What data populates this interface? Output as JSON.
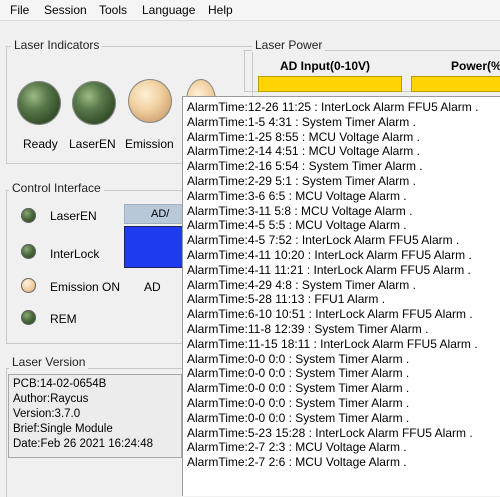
{
  "menu": [
    "File",
    "Session",
    "Tools",
    "Language",
    "Help"
  ],
  "laser_indicators": {
    "title": "Laser Indicators",
    "items": [
      {
        "label": "Ready",
        "state": "green"
      },
      {
        "label": "LaserEN",
        "state": "green"
      },
      {
        "label": "Emission",
        "state": "peach"
      }
    ]
  },
  "laser_power": {
    "title": "Laser Power",
    "ad_input_label": "AD Input(0-10V)",
    "power_label": "Power(%"
  },
  "control_interface": {
    "title": "Control Interface",
    "items": [
      {
        "label": "LaserEN",
        "state": "green"
      },
      {
        "label": "InterLock",
        "state": "green"
      },
      {
        "label": "Emission ON",
        "state": "peach"
      },
      {
        "label": "REM",
        "state": "green"
      }
    ],
    "ad_header": "AD/",
    "ad_label": "AD"
  },
  "laser_version": {
    "title": "Laser Version",
    "lines": [
      "PCB:14-02-0654B",
      "Author:Raycus",
      "Version:3.7.0",
      "Brief:Single Module",
      "Date:Feb 26 2021  16:24:48"
    ]
  },
  "alarms": [
    "AlarmTime:12-26 11:25  :   InterLock Alarm  FFU5 Alarm  .",
    "AlarmTime:1-5 4:31  :   System Timer Alarm  .",
    "AlarmTime:1-25 8:55  :   MCU Voltage Alarm  .",
    "AlarmTime:2-14 4:51  :   MCU Voltage Alarm  .",
    "AlarmTime:2-16 5:54  :   System Timer Alarm  .",
    "AlarmTime:2-29 5:1  :   System Timer Alarm  .",
    "AlarmTime:3-6 6:5  :   MCU Voltage Alarm  .",
    "AlarmTime:3-11 5:8  :   MCU Voltage Alarm  .",
    "AlarmTime:4-5 5:5  :   MCU Voltage Alarm  .",
    "AlarmTime:4-5 7:52  :   InterLock Alarm  FFU5 Alarm  .",
    "AlarmTime:4-11 10:20  :   InterLock Alarm  FFU5 Alarm  .",
    "AlarmTime:4-11 11:21  :   InterLock Alarm  FFU5 Alarm  .",
    "AlarmTime:4-29 4:8  :   System Timer Alarm  .",
    "AlarmTime:5-28 11:13  :   FFU1 Alarm  .",
    "AlarmTime:6-10 10:51  :   InterLock Alarm  FFU5 Alarm  .",
    "AlarmTime:11-8 12:39  :   System Timer Alarm  .",
    "AlarmTime:11-15 18:11  :   InterLock Alarm  FFU5 Alarm  .",
    "AlarmTime:0-0 0:0  :   System Timer Alarm  .",
    "AlarmTime:0-0 0:0  :   System Timer Alarm  .",
    "AlarmTime:0-0 0:0  :   System Timer Alarm  .",
    "AlarmTime:0-0 0:0  :   System Timer Alarm  .",
    "AlarmTime:0-0 0:0  :   System Timer Alarm  .",
    "AlarmTime:5-23 15:28  :   InterLock Alarm  FFU5 Alarm  .",
    "AlarmTime:2-7 2:3  :   MCU Voltage Alarm  .",
    "AlarmTime:2-7 2:6  :   MCU Voltage Alarm  ."
  ],
  "colors": {
    "led_green": "#3c5a30",
    "led_peach": "#f0d0a0",
    "blue_box": "#1f3bf0",
    "power_bar": "#ffd400"
  }
}
